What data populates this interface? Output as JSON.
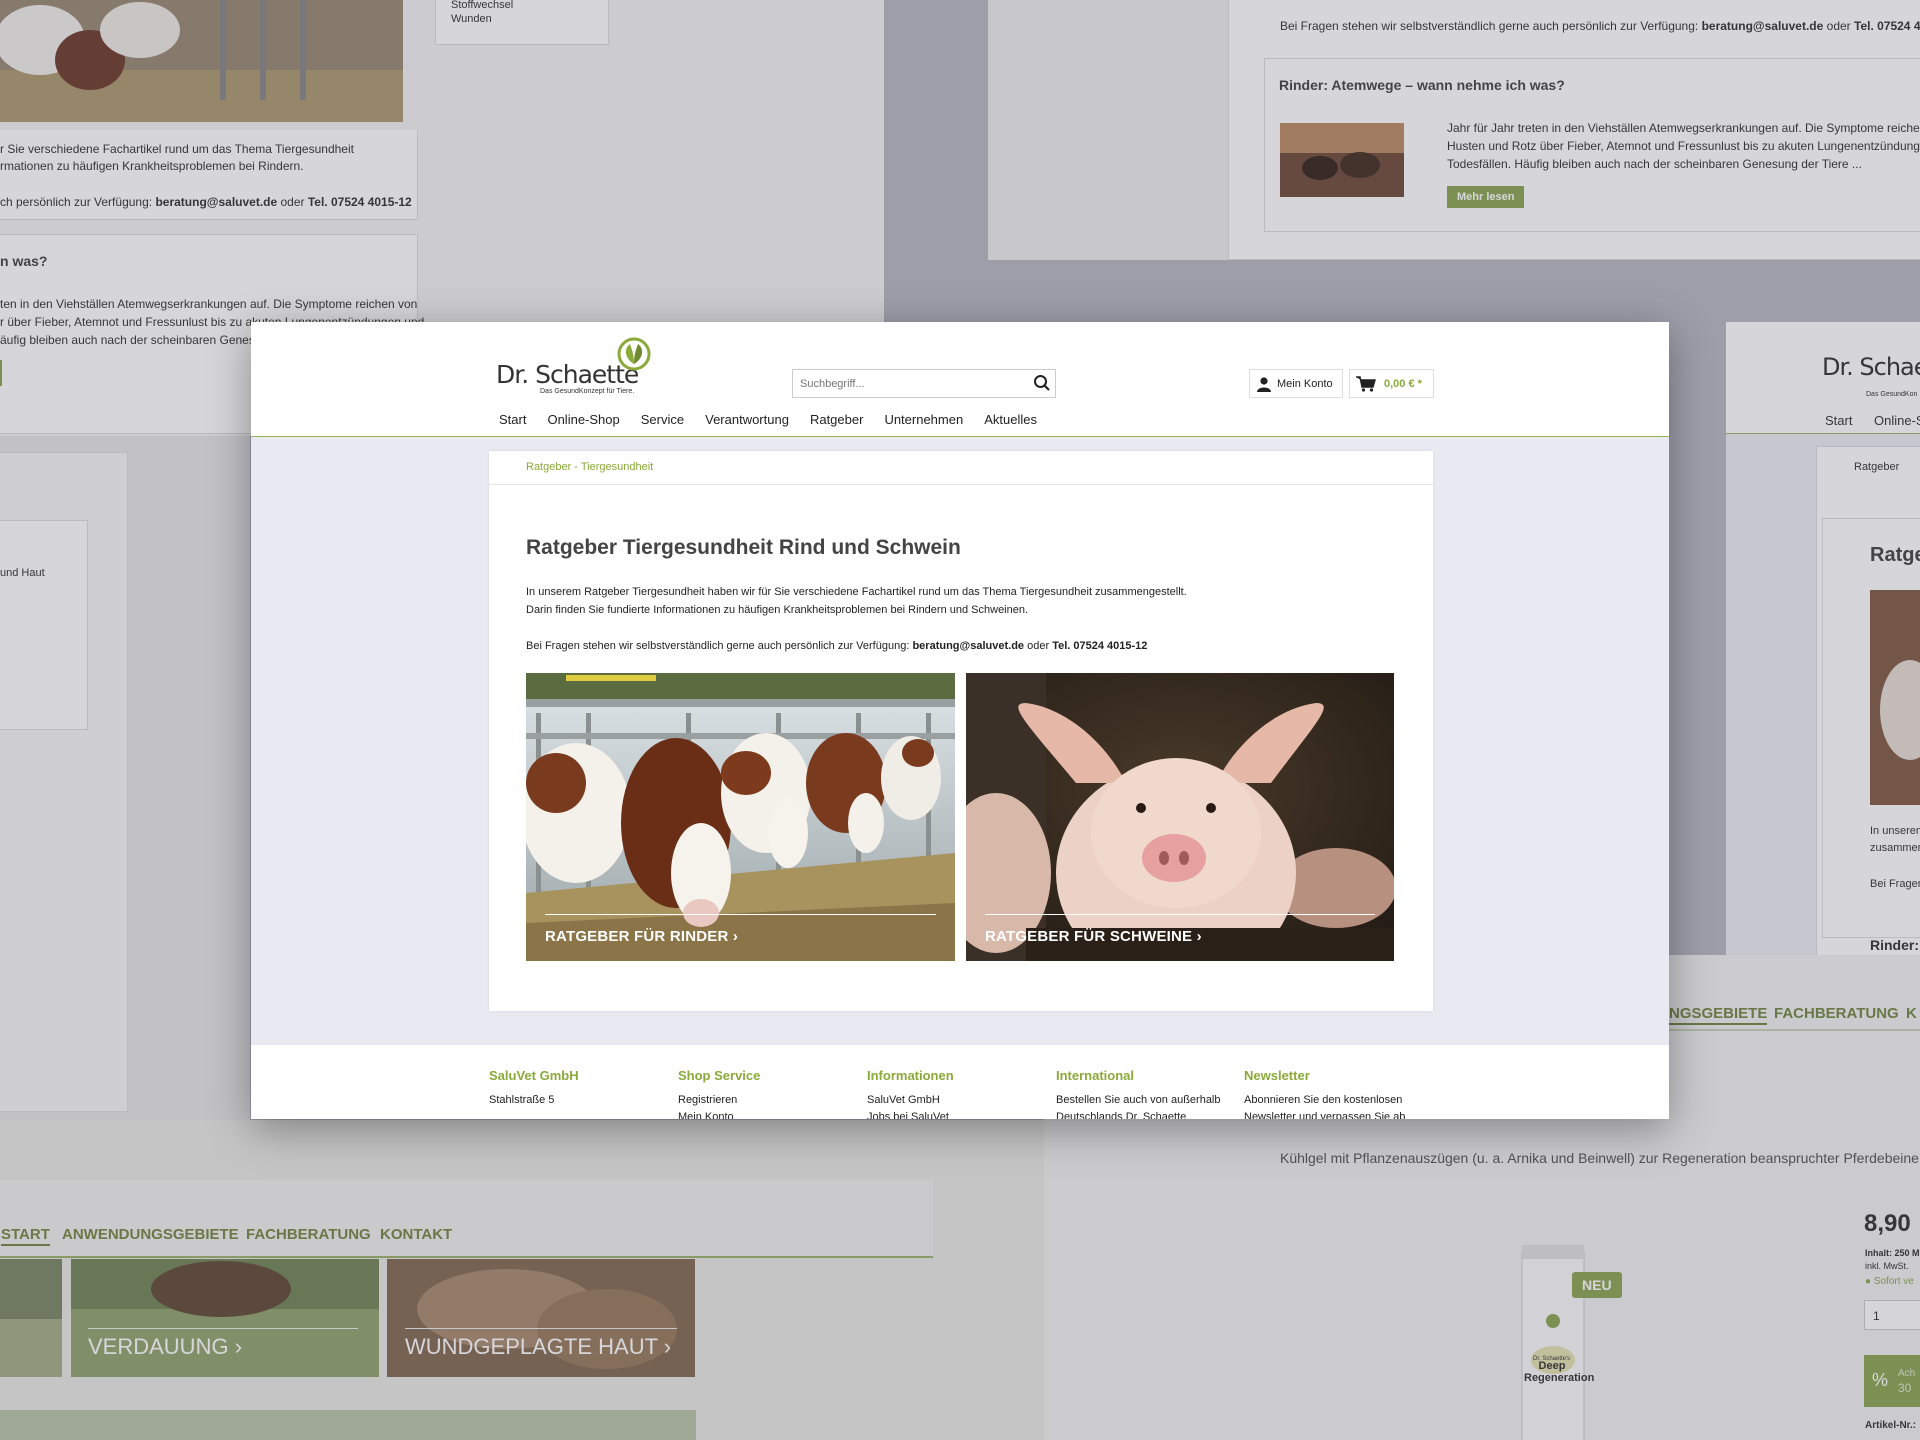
{
  "background": {
    "top_left": {
      "items": [
        "Stoffwechsel",
        "Wunden"
      ],
      "text1": "r Sie verschiedene Fachartikel rund um das Thema Tiergesundheit",
      "text2": "rmationen zu häufigen Krankheitsproblemen bei Rindern.",
      "contact_prefix": "ch persönlich zur Verfügung: ",
      "email": "beratung@saluvet.de",
      "oder": " oder ",
      "phone": "Tel. 07524 4015-12",
      "heading": "n was?",
      "body1": "ten in den Viehställen Atemwegserkrankungen auf. Die Symptome reichen von",
      "body2": "r über Fieber, Atemnot und Fressunlust bis zu akuten Lungenentzündungen und",
      "body3": "äufig bleiben auch nach der scheinbaren Genesung d"
    },
    "top_right": {
      "contact_prefix": "Bei Fragen stehen wir selbstverständlich gerne auch persönlich zur Verfügung: ",
      "email": "beratung@saluvet.de",
      "oder": " oder ",
      "phone": "Tel. 07524 4015-12",
      "heading": "Rinder: Atemwege – wann nehme ich was?",
      "body1": "Jahr für Jahr treten in den Viehställen Atemwegserkrankungen auf. Die Symptome reichen von",
      "body2": "Husten und Rotz über Fieber, Atemnot und Fressunlust bis zu akuten Lungenentzündungen und",
      "body3": "Todesfällen. Häufig bleiben auch nach der scheinbaren Genesung der Tiere ...",
      "button": "Mehr lesen"
    },
    "left_mid": {
      "text": "und Haut"
    },
    "right_mid": {
      "logo": "Dr. Schaette",
      "logo_tag": "Das GesundKon",
      "nav": [
        "Start",
        "Online-S"
      ],
      "crumb": "Ratgeber",
      "heading": "Ratge",
      "text1": "In unserem",
      "text2": "zusammen",
      "text3": "Bei Fragen",
      "sub": "Rinder:"
    },
    "bottom_left": {
      "nav": [
        "START",
        "ANWENDUNGSGEBIETE",
        "FACHBERATUNG",
        "KONTAKT"
      ],
      "tiles": [
        "VERDAUUNG",
        "WUNDGEPLAGTE HAUT"
      ]
    },
    "bottom_right": {
      "nav": [
        "NGSGEBIETE",
        "FACHBERATUNG",
        "K"
      ],
      "subtitle": "Kühlgel mit Pflanzenauszügen (u. a. Arnika und Beinwell) zur Regeneration beanspruchter Pferdebeine",
      "badge": "NEU",
      "price": "8,90",
      "inhalt": "Inhalt: 250 M",
      "mwst": "inkl. MwSt.",
      "avail": "Sofort ve",
      "qty": "1",
      "percent": "%",
      "ach": "Ach",
      "num": "30",
      "artnr": "Artikel-Nr.:",
      "product_brand": "Dr. Schaette's",
      "product_name": "Deep Regeneration"
    }
  },
  "header": {
    "logo_name": "Dr. Schaette",
    "logo_tag": "Das GesundKonzept für Tiere.",
    "search_placeholder": "Suchbegriff...",
    "account": "Mein Konto",
    "cart_total": "0,00 € *",
    "nav": [
      "Start",
      "Online-Shop",
      "Service",
      "Verantwortung",
      "Ratgeber",
      "Unternehmen",
      "Aktuelles"
    ]
  },
  "content": {
    "breadcrumb": "Ratgeber - Tiergesundheit",
    "title": "Ratgeber Tiergesundheit Rind und Schwein",
    "intro1": "In unserem Ratgeber Tiergesundheit haben wir für Sie verschiedene Fachartikel rund um das Thema Tiergesundheit zusammengestellt.",
    "intro2": "Darin finden Sie fundierte Informationen zu häufigen Krankheitsproblemen bei Rindern und Schweinen.",
    "contact_prefix": "Bei Fragen stehen wir selbstverständlich gerne auch persönlich zur Verfügung: ",
    "email": "beratung@saluvet.de",
    "oder": " oder ",
    "phone": "Tel. 07524 4015-12",
    "tiles": [
      {
        "label": "RATGEBER FÜR RINDER"
      },
      {
        "label": "RATGEBER FÜR SCHWEINE"
      }
    ]
  },
  "footer": {
    "columns": [
      {
        "title": "SaluVet GmbH",
        "lines": [
          "Stahlstraße 5"
        ]
      },
      {
        "title": "Shop Service",
        "lines": [
          "Registrieren",
          "Mein Konto"
        ]
      },
      {
        "title": "Informationen",
        "lines": [
          "SaluVet GmbH",
          "Jobs bei SaluVet"
        ]
      },
      {
        "title": "International",
        "lines": [
          "Bestellen Sie auch von außerhalb",
          "Deutschlands Dr. Schaette"
        ]
      },
      {
        "title": "Newsletter",
        "lines": [
          "Abonnieren Sie den kostenlosen",
          "Newsletter und verpassen Sie ab"
        ]
      }
    ]
  },
  "colors": {
    "accent": "#8aaa3a",
    "page_bg": "#e9e9f2"
  }
}
